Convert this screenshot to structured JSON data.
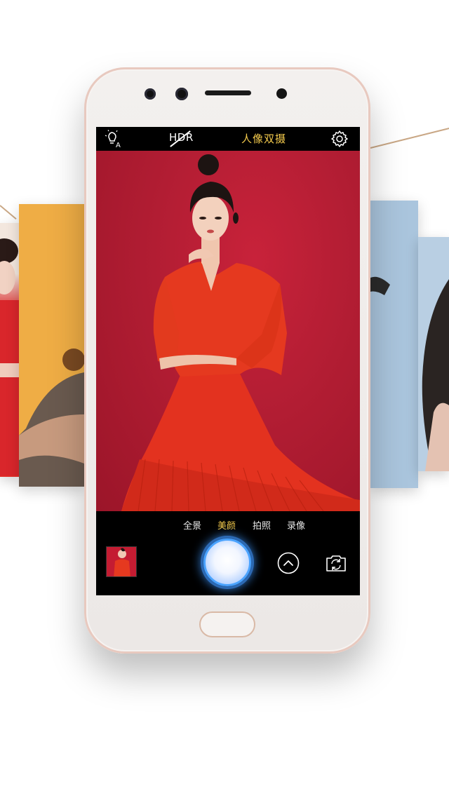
{
  "camera": {
    "topbar": {
      "flash_icon": "bulb-auto-icon",
      "hdr_label": "HDR",
      "mode_title": "人像双摄",
      "settings_icon": "gear-icon"
    },
    "modes": [
      {
        "label": "全景",
        "active": false
      },
      {
        "label": "美颜",
        "active": true
      },
      {
        "label": "拍照",
        "active": false
      },
      {
        "label": "录像",
        "active": false
      }
    ],
    "controls": {
      "gallery_icon": "gallery-thumbnail",
      "shutter_icon": "shutter-button",
      "expand_icon": "chevron-up-icon",
      "switch_icon": "camera-switch-icon"
    }
  },
  "colors": {
    "accent_yellow": "#f2c94c",
    "shutter_blue": "#4aa3ff",
    "backdrop_red": "#b21d33",
    "phone_rose": "#e8c9bf"
  }
}
